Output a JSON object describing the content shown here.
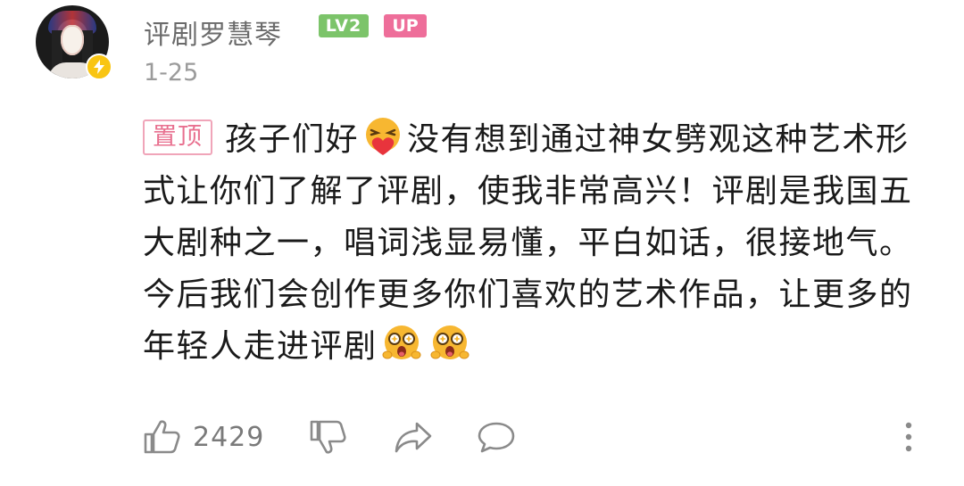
{
  "comment": {
    "username": "评剧罗慧琴",
    "level_badge": "LV2",
    "up_badge": "UP",
    "date": "1-25",
    "pin_label": "置顶",
    "text_part1": "孩子们好",
    "text_part2": "没有想到通过神女劈观这种艺术形式让你们了解了评剧，使我非常高兴！评剧是我国五大剧种之一，唱词浅显易懂，平白如话，很接地气。今后我们会创作更多你们喜欢的艺术作品，让更多的年轻人走进评剧",
    "emojis": [
      "love-heart-emoji",
      "excited-emoji",
      "excited-emoji"
    ]
  },
  "actions": {
    "like_count": "2429",
    "icons": [
      "thumbs-up-icon",
      "thumbs-down-icon",
      "share-icon",
      "reply-icon",
      "more-icon"
    ]
  },
  "colors": {
    "level_badge": "#7cc46a",
    "up_badge": "#ee6e9a",
    "pin_tag": "#e8708f",
    "verify_badge": "#f9c513"
  }
}
